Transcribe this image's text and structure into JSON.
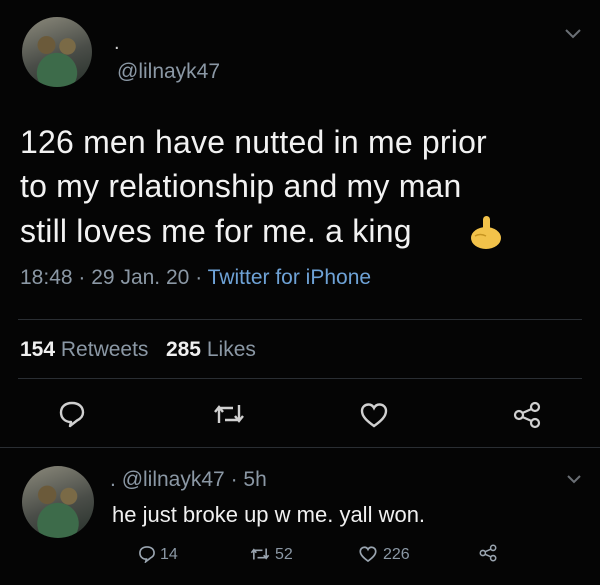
{
  "tweet": {
    "avatar_dot": ".",
    "handle": "@lilnayk47",
    "text_line1": "126 men have nutted in me prior",
    "text_line2": "to my relationship and my man",
    "text_line3": "still loves me for me. a king",
    "emoji": "pointing-up-hand-emoji",
    "time": "18:48",
    "sep1": "·",
    "date": "29 Jan. 20",
    "sep2": "·",
    "source": "Twitter for iPhone",
    "retweet_count": "154",
    "retweet_label": "Retweets",
    "like_count": "285",
    "like_label": "Likes",
    "actions": [
      "reply-icon",
      "retweet-icon",
      "like-icon",
      "share-icon"
    ]
  },
  "reply": {
    "dot": ".",
    "handle": "@lilnayk47",
    "sep": "·",
    "age": "5h",
    "text": "he just broke up w me. yall won.",
    "reply_count": "14",
    "retweet_count": "52",
    "like_count": "226"
  },
  "colors": {
    "background": "#050505",
    "muted": "#8b98a5",
    "link": "#6ea2d6",
    "text": "#f2f2f2"
  }
}
